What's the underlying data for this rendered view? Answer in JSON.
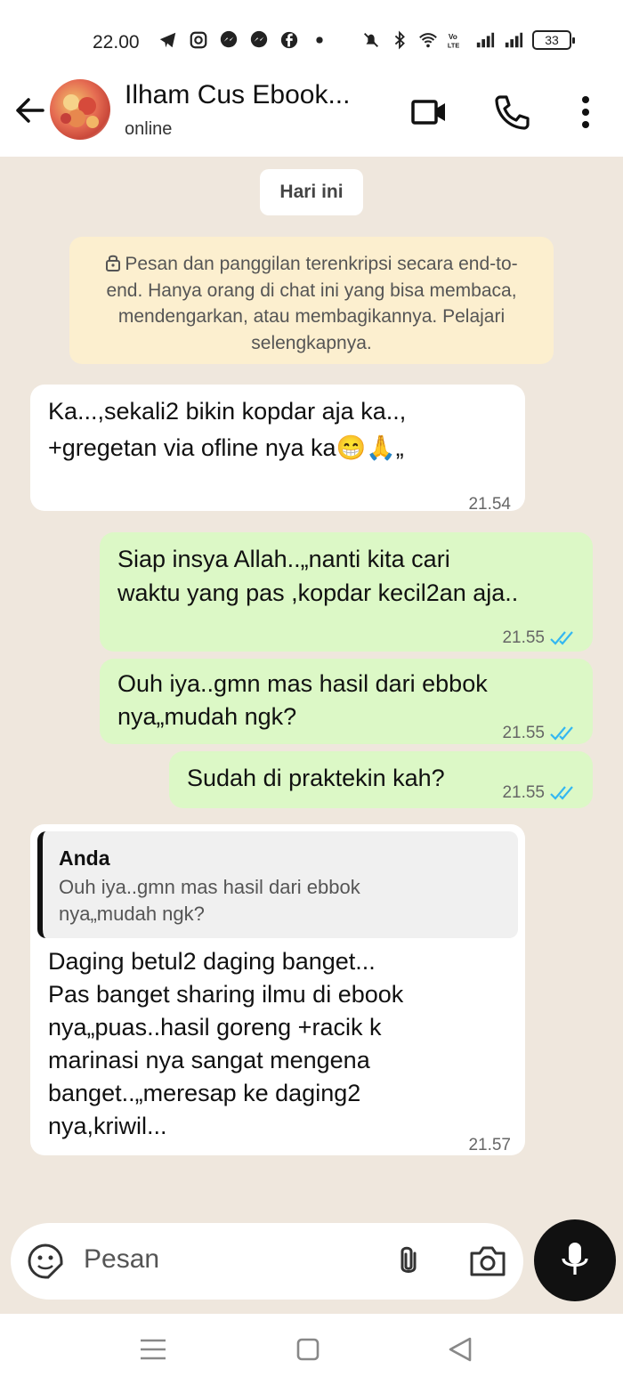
{
  "status_bar": {
    "time": "22.00",
    "battery": "33",
    "icons": [
      "telegram-icon",
      "instagram-icon",
      "messenger-icon",
      "messenger-icon",
      "facebook-icon",
      "dot-icon",
      "mute-icon",
      "bluetooth-icon",
      "wifi-icon",
      "volte-icon",
      "signal-icon",
      "signal-icon",
      "battery-icon"
    ]
  },
  "header": {
    "contact_name": "Ilham Cus Ebook...",
    "status": "online",
    "icons": [
      "back-arrow-icon",
      "video-call-icon",
      "voice-call-icon",
      "more-vert-icon"
    ]
  },
  "chat": {
    "day_label": "Hari ini",
    "encryption_notice": "Pesan dan panggilan terenkripsi secara end-to-end. Hanya orang di chat ini yang bisa membaca, mendengarkan, atau membagikannya. Pelajari selengkapnya.",
    "messages": [
      {
        "direction": "in",
        "line1": "Ka...,sekali2 bikin kopdar aja ka..,",
        "line2": "+gregetan via ofline nya ka😁🙏„",
        "time": "21.54"
      },
      {
        "direction": "out",
        "line1": "Siap insya Allah..„nanti kita cari",
        "line2": "waktu yang pas ,kopdar kecil2an aja..",
        "time": "21.55",
        "status": "read"
      },
      {
        "direction": "out",
        "line1": "Ouh iya..gmn mas hasil dari ebbok",
        "line2": "nya„mudah ngk?",
        "time": "21.55",
        "status": "read"
      },
      {
        "direction": "out",
        "line1": "Sudah di praktekin kah?",
        "time": "21.55",
        "status": "read"
      },
      {
        "direction": "in",
        "quote_author": "Anda",
        "quote_line1": "Ouh iya..gmn mas hasil dari ebbok",
        "quote_line2": "nya„mudah ngk?",
        "lines": [
          "Daging betul2 daging banget...",
          "Pas banget  sharing ilmu di ebook",
          "nya„puas..hasil goreng +racik k",
          "marinasi nya sangat mengena",
          "banget..„meresap ke daging2",
          "nya,kriwil..."
        ],
        "time": "21.57"
      }
    ]
  },
  "input": {
    "placeholder": "Pesan",
    "icons": [
      "sticker-icon",
      "attach-icon",
      "camera-icon",
      "mic-icon"
    ]
  },
  "colors": {
    "chat_bg": "#efe7dd",
    "outgoing_bubble": "#dcf8c6",
    "incoming_bubble": "#ffffff",
    "notice_bg": "#fcefcf",
    "read_tick": "#34b7f1"
  }
}
